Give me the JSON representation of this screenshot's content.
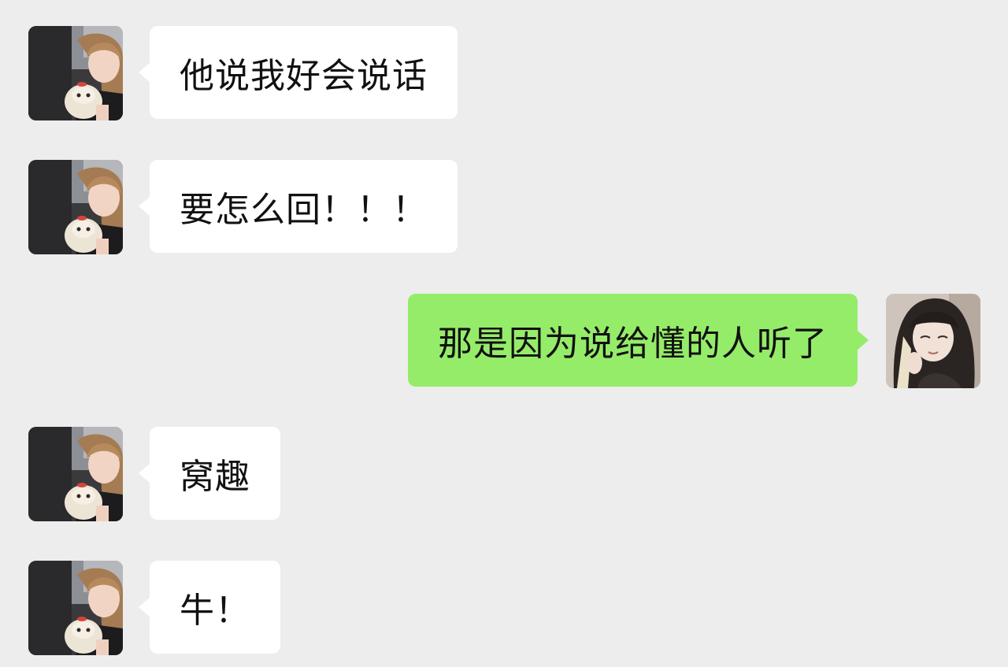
{
  "colors": {
    "background": "#ededed",
    "incoming_bubble": "#ffffff",
    "outgoing_bubble": "#95ec69",
    "text": "#111111"
  },
  "messages": [
    {
      "direction": "incoming",
      "avatar": "friend-avatar",
      "text": "他说我好会说话"
    },
    {
      "direction": "incoming",
      "avatar": "friend-avatar",
      "text": "要怎么回！！！"
    },
    {
      "direction": "outgoing",
      "avatar": "self-avatar",
      "text": "那是因为说给懂的人听了"
    },
    {
      "direction": "incoming",
      "avatar": "friend-avatar",
      "text": "窝趣"
    },
    {
      "direction": "incoming",
      "avatar": "friend-avatar",
      "text": "牛！"
    }
  ]
}
